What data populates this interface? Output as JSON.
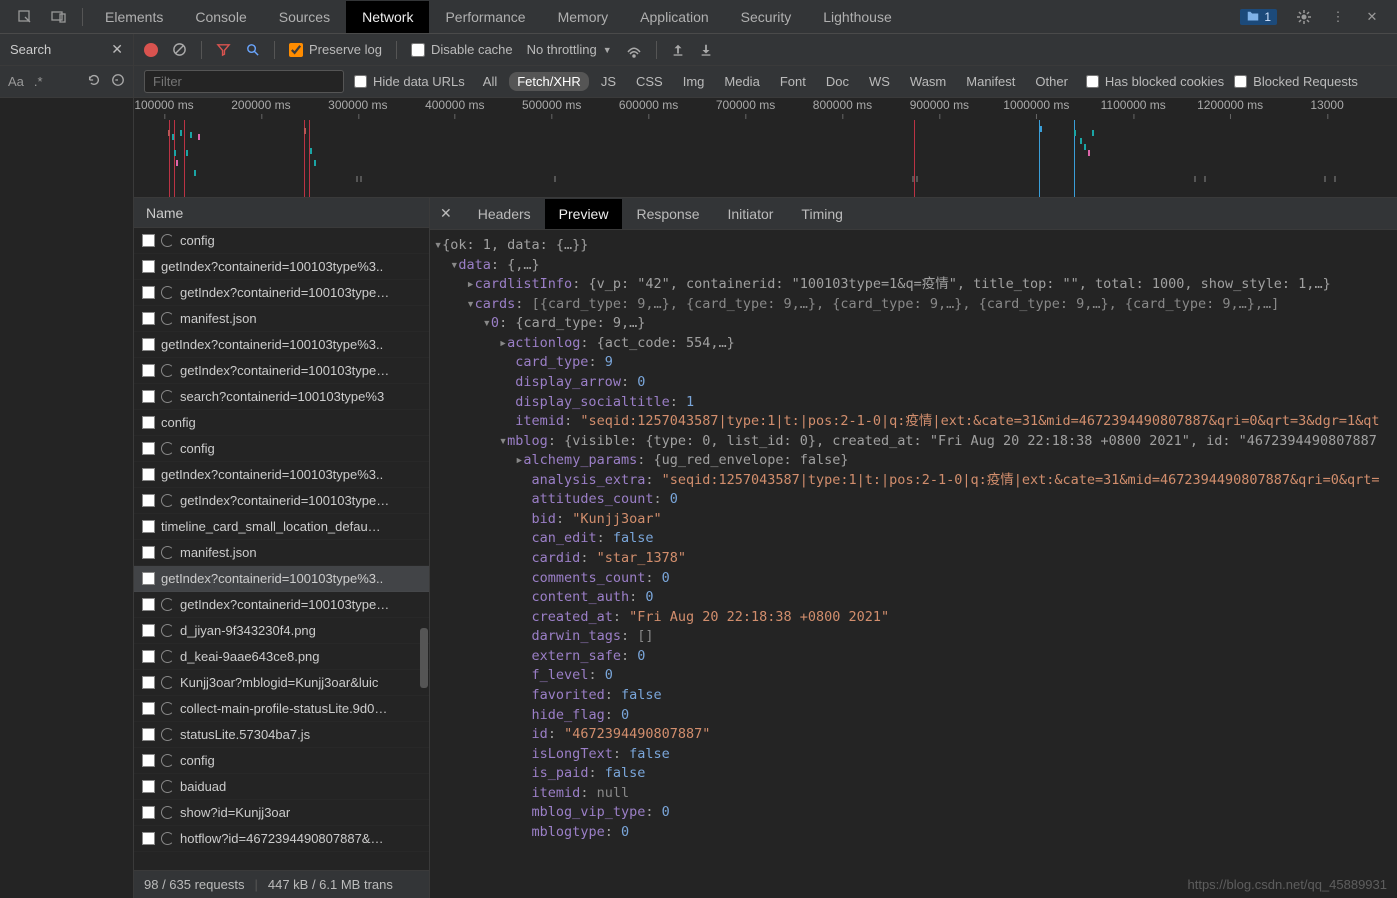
{
  "top_tabs": {
    "items": [
      "Elements",
      "Console",
      "Sources",
      "Network",
      "Performance",
      "Memory",
      "Application",
      "Security",
      "Lighthouse"
    ],
    "active_index": 3,
    "badge_count": "1"
  },
  "search_sidebar": {
    "title": "Search",
    "match_case": "Aa",
    "regex": ".*"
  },
  "toolbar": {
    "preserve_log_label": "Preserve log",
    "preserve_log_checked": true,
    "disable_cache_label": "Disable cache",
    "disable_cache_checked": false,
    "throttling": "No throttling"
  },
  "filterbar": {
    "filter_placeholder": "Filter",
    "hide_data_urls_label": "Hide data URLs",
    "types": [
      "All",
      "Fetch/XHR",
      "JS",
      "CSS",
      "Img",
      "Media",
      "Font",
      "Doc",
      "WS",
      "Wasm",
      "Manifest",
      "Other"
    ],
    "active_type_index": 1,
    "has_blocked_cookies_label": "Has blocked cookies",
    "blocked_requests_label": "Blocked Requests"
  },
  "timeline": {
    "ticks": [
      "100000 ms",
      "200000 ms",
      "300000 ms",
      "400000 ms",
      "500000 ms",
      "600000 ms",
      "700000 ms",
      "800000 ms",
      "900000 ms",
      "1000000 ms",
      "1100000 ms",
      "1200000 ms",
      "13000"
    ]
  },
  "reqlist": {
    "header": "Name",
    "items": [
      {
        "icon": "spin",
        "name": "config"
      },
      {
        "icon": "cb",
        "name": "getIndex?containerid=100103type%3.."
      },
      {
        "icon": "spin",
        "name": "getIndex?containerid=100103type…"
      },
      {
        "icon": "spin",
        "name": "manifest.json"
      },
      {
        "icon": "cb",
        "name": "getIndex?containerid=100103type%3.."
      },
      {
        "icon": "spin",
        "name": "getIndex?containerid=100103type…"
      },
      {
        "icon": "spin",
        "name": "search?containerid=100103type%3"
      },
      {
        "icon": "cb",
        "name": "config"
      },
      {
        "icon": "spin",
        "name": "config"
      },
      {
        "icon": "cb",
        "name": "getIndex?containerid=100103type%3.."
      },
      {
        "icon": "spin",
        "name": "getIndex?containerid=100103type…"
      },
      {
        "icon": "cb",
        "name": "timeline_card_small_location_defau…"
      },
      {
        "icon": "spin",
        "name": "manifest.json"
      },
      {
        "icon": "cb",
        "name": "getIndex?containerid=100103type%3..",
        "selected": true
      },
      {
        "icon": "spin",
        "name": "getIndex?containerid=100103type…"
      },
      {
        "icon": "spin",
        "name": "d_jiyan-9f343230f4.png"
      },
      {
        "icon": "spin",
        "name": "d_keai-9aae643ce8.png"
      },
      {
        "icon": "spin",
        "name": "Kunjj3oar?mblogid=Kunjj3oar&luic"
      },
      {
        "icon": "spin",
        "name": "collect-main-profile-statusLite.9d0…"
      },
      {
        "icon": "spin",
        "name": "statusLite.57304ba7.js"
      },
      {
        "icon": "spin",
        "name": "config"
      },
      {
        "icon": "spin",
        "name": "baiduad"
      },
      {
        "icon": "spin",
        "name": "show?id=Kunjj3oar"
      },
      {
        "icon": "spin",
        "name": "hotflow?id=4672394490807887&…"
      }
    ],
    "status_requests": "98 / 635 requests",
    "status_transfer": "447 kB / 6.1 MB trans"
  },
  "detail": {
    "tabs": [
      "Headers",
      "Preview",
      "Response",
      "Initiator",
      "Timing"
    ],
    "active_index": 1
  },
  "json_preview": {
    "root_summary": "{ok: 1, data: {…}}",
    "data_label": "data",
    "data_summary": "{,…}",
    "cardlistInfo": "{v_p: \"42\", containerid: \"100103type=1&q=疫情\", title_top: \"\", total: 1000, show_style: 1,…}",
    "cards_summary": "[{card_type: 9,…}, {card_type: 9,…}, {card_type: 9,…}, {card_type: 9,…}, {card_type: 9,…},…]",
    "card0_summary": "{card_type: 9,…}",
    "actionlog": "{act_code: 554,…}",
    "card_type": "9",
    "display_arrow": "0",
    "display_socialtitle": "1",
    "itemid": "\"seqid:1257043587|type:1|t:|pos:2-1-0|q:疫情|ext:&cate=31&mid=4672394490807887&qri=0&qrt=3&dgr=1&qt",
    "mblog_summary": "{visible: {type: 0, list_id: 0}, created_at: \"Fri Aug 20 22:18:38 +0800 2021\", id: \"4672394490807887",
    "alchemy_params": "{ug_red_envelope: false}",
    "analysis_extra": "\"seqid:1257043587|type:1|t:|pos:2-1-0|q:疫情|ext:&cate=31&mid=4672394490807887&qri=0&qrt=",
    "attitudes_count": "0",
    "bid": "\"Kunjj3oar\"",
    "can_edit": "false",
    "cardid": "\"star_1378\"",
    "comments_count": "0",
    "content_auth": "0",
    "created_at": "\"Fri Aug 20 22:18:38 +0800 2021\"",
    "darwin_tags": "[]",
    "extern_safe": "0",
    "f_level": "0",
    "favorited": "false",
    "hide_flag": "0",
    "id": "\"4672394490807887\"",
    "isLongText": "false",
    "is_paid": "false",
    "itemid2": "null",
    "mblog_vip_type": "0",
    "mblogtype": "0"
  },
  "watermark": "https://blog.csdn.net/qq_45889931"
}
